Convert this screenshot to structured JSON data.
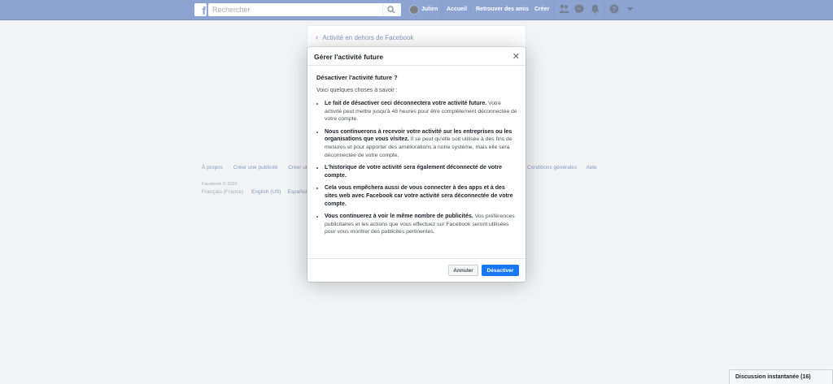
{
  "topbar": {
    "logo": "f",
    "search_placeholder": "Rechercher",
    "user_name": "Julien",
    "nav": [
      "Accueil",
      "Retrouver des amis",
      "Créer"
    ],
    "icons": [
      "friends-icon",
      "messenger-icon",
      "notifications-icon",
      "help-icon",
      "menu-caret-icon"
    ]
  },
  "page": {
    "back_link": "Activité en dehors de Facebook",
    "footer_left": [
      "À propos",
      "Créer une publicité",
      "Créer un"
    ],
    "footer_right": [
      "Conditions générales",
      "Aide"
    ],
    "copyright": "Facebook © 2020",
    "langs": [
      "Français (France)",
      "English (US)",
      "Español"
    ]
  },
  "dialog": {
    "title": "Gérer l'activité future",
    "question": "Désactiver l'activité future ?",
    "intro": "Voici quelques choses à savoir :",
    "bullets": [
      {
        "bold": "Le fait de désactiver ceci déconnectera votre activité future.",
        "text": " Votre activité peut mettre jusqu'à 48 heures pour être complètement déconnectée de votre compte."
      },
      {
        "bold": "Nous continuerons à recevoir votre activité sur les entreprises ou les organisations que vous visitez.",
        "text": " Il se peut qu'elle soit utilisée à des fins de mesures et pour apporter des améliorations à notre système, mais elle sera déconnectée de votre compte."
      },
      {
        "bold": "L'historique de votre activité sera également déconnecté de votre compte.",
        "text": ""
      },
      {
        "bold": "Cela vous empêchera aussi de vous connecter à des apps et à des sites web avec Facebook car votre activité sera déconnectée de votre compte.",
        "text": ""
      },
      {
        "bold": "Vous continuerez à voir le même nombre de publicités.",
        "text": " Vos préférences publicitaires et les actions que vous effectuez sur Facebook seront utilisées pour vous montrer des publicités pertinentes."
      }
    ],
    "cancel_label": "Annuler",
    "confirm_label": "Désactiver"
  },
  "chat": {
    "label": "Discussion instantanée (16)"
  },
  "colors": {
    "brand": "#4267b2",
    "primary_button": "#1877f2",
    "background": "#e9ebee"
  }
}
